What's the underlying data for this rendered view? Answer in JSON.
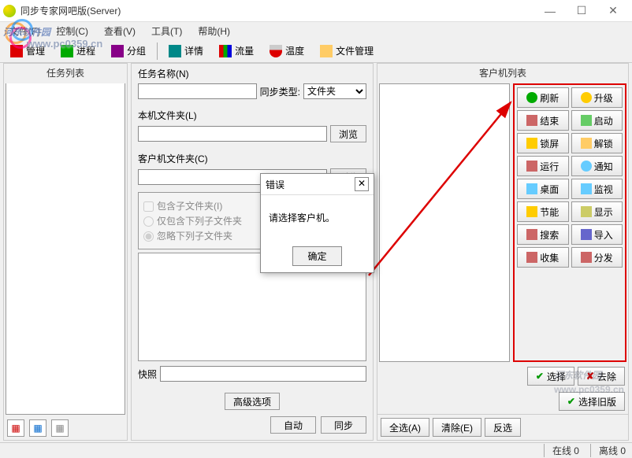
{
  "window": {
    "title": "同步专家网吧版(Server)",
    "min": "—",
    "max": "☐",
    "close": "✕"
  },
  "menu": {
    "items": [
      "文件(F)",
      "控制(C)",
      "查看(V)",
      "工具(T)",
      "帮助(H)"
    ]
  },
  "toolbar": {
    "items": [
      "管理",
      "进程",
      "分组",
      "详情",
      "流量",
      "温度",
      "文件管理"
    ]
  },
  "left": {
    "header": "任务列表"
  },
  "mid": {
    "task_name_label": "任务名称(N)",
    "sync_type_label": "同步类型:",
    "sync_type_value": "文件夹",
    "local_folder_label": "本机文件夹(L)",
    "client_folder_label": "客户机文件夹(C)",
    "browse": "浏览",
    "include_sub": "包含子文件夹(I)",
    "only_sub": "仅包含下列子文件夹",
    "ignore_sub": "忽略下列子文件夹",
    "snapshot_label": "快照",
    "advanced": "高级选项",
    "auto": "自动",
    "sync": "同步"
  },
  "right": {
    "header": "客户机列表",
    "actions": [
      {
        "label": "刷新",
        "icon": "refresh"
      },
      {
        "label": "升级",
        "icon": "upgrade"
      },
      {
        "label": "结束",
        "icon": "end"
      },
      {
        "label": "启动",
        "icon": "start"
      },
      {
        "label": "锁屏",
        "icon": "lock"
      },
      {
        "label": "解锁",
        "icon": "unlock"
      },
      {
        "label": "运行",
        "icon": "run"
      },
      {
        "label": "通知",
        "icon": "notify"
      },
      {
        "label": "桌面",
        "icon": "desk"
      },
      {
        "label": "监视",
        "icon": "monitor"
      },
      {
        "label": "节能",
        "icon": "eco"
      },
      {
        "label": "显示",
        "icon": "display"
      },
      {
        "label": "搜索",
        "icon": "search"
      },
      {
        "label": "导入",
        "icon": "import"
      },
      {
        "label": "收集",
        "icon": "collect"
      },
      {
        "label": "分发",
        "icon": "dist"
      }
    ],
    "select": "选择",
    "remove": "去除",
    "select_old": "选择旧版",
    "select_all": "全选(A)",
    "clear": "清除(E)",
    "invert": "反选"
  },
  "status": {
    "online": "在线 0",
    "offline": "离线 0"
  },
  "dialog": {
    "title": "错误",
    "message": "请选择客户机。",
    "ok": "确定"
  },
  "watermark": {
    "text": "河东软件园",
    "url": "www.pc0359.cn"
  }
}
